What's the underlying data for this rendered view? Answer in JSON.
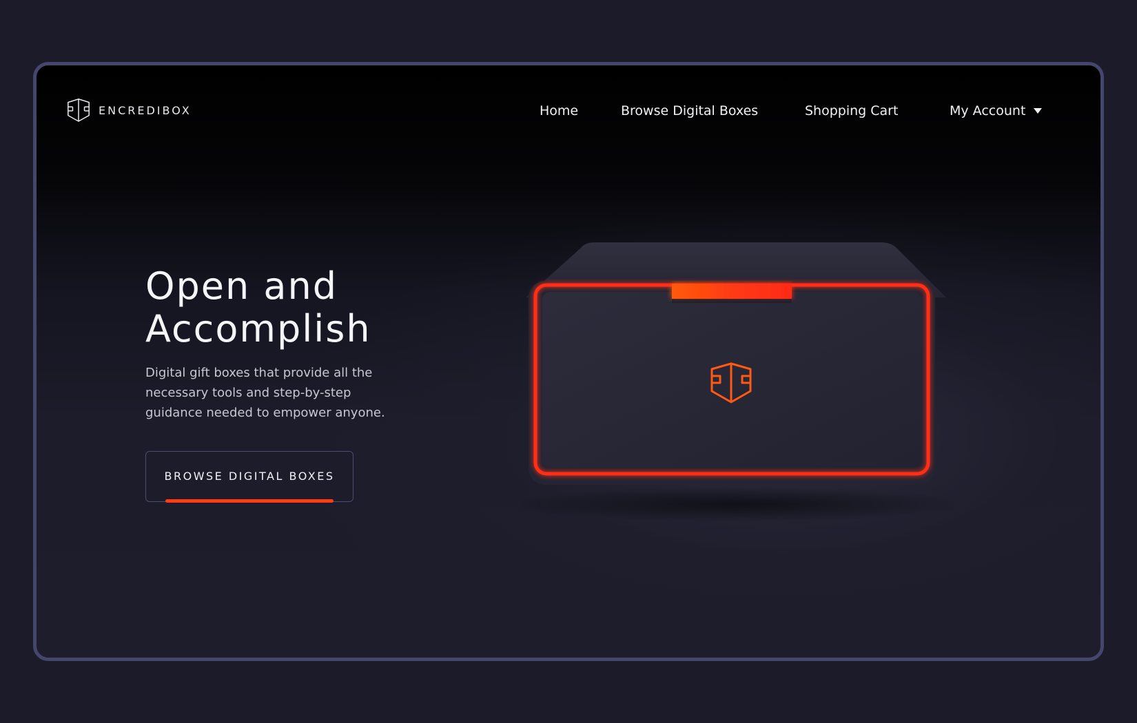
{
  "brand": {
    "name": "ENCREDIBOX",
    "logo_icon": "cube-shield-icon"
  },
  "nav": {
    "items": [
      {
        "label": "Home"
      },
      {
        "label": "Browse Digital Boxes"
      },
      {
        "label": "Shopping Cart"
      },
      {
        "label": "My Account"
      }
    ],
    "account_dropdown_icon": "caret-down-icon"
  },
  "hero": {
    "title_line1": "Open and",
    "title_line2": "Accomplish",
    "subtitle": "Digital gift boxes that provide all the necessary tools and step-by-step guidance needed to empower anyone.",
    "cta_label": "BROWSE DIGITAL BOXES"
  },
  "colors": {
    "page_background": "#1b1b29",
    "frame_border": "#45466e",
    "accent": "#ff3b14",
    "text": "#f1f1f5"
  }
}
